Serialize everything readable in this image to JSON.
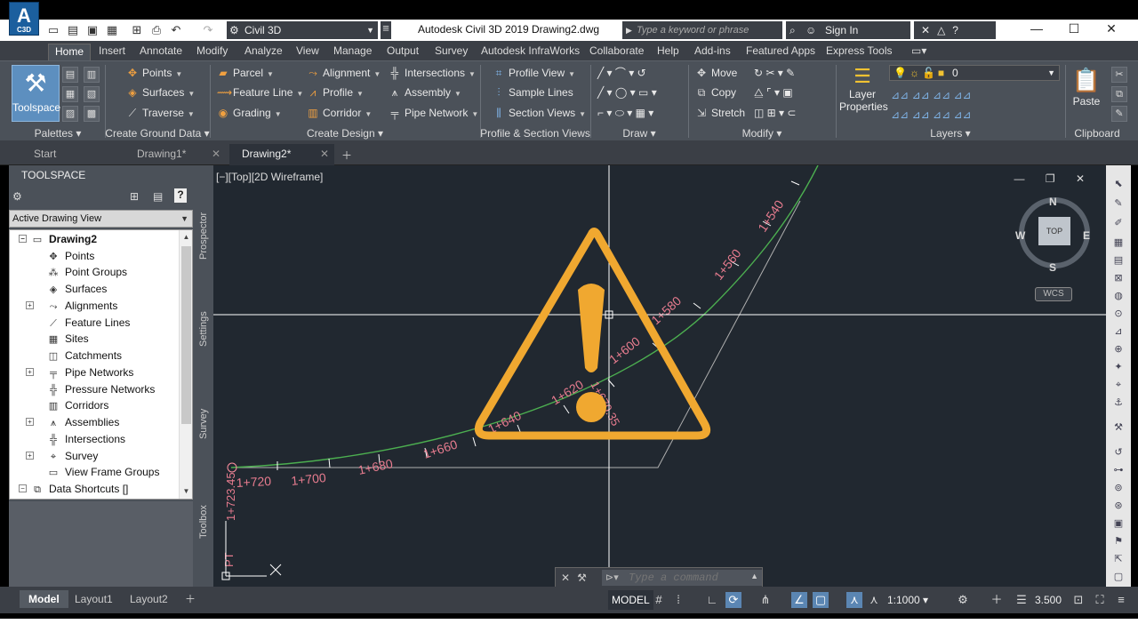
{
  "titlebar": {
    "logo_text": "A",
    "logo_sub": "C3D",
    "workspace": "Civil 3D",
    "app_title": "Autodesk Civil 3D 2019",
    "doc_title": "Drawing2.dwg",
    "search_placeholder": "Type a keyword or phrase",
    "sign_in": "Sign In"
  },
  "ribbon_tabs": [
    "Home",
    "Insert",
    "Annotate",
    "Modify",
    "Analyze",
    "View",
    "Manage",
    "Output",
    "Survey",
    "Autodesk InfraWorks",
    "Collaborate",
    "Help",
    "Add-ins",
    "Featured Apps",
    "Express Tools"
  ],
  "ribbon": {
    "toolspace": "Toolspace",
    "create_ground": [
      "Points",
      "Surfaces",
      "Traverse"
    ],
    "create_design_col1": [
      "Parcel",
      "Feature Line",
      "Grading"
    ],
    "create_design_col2": [
      "Alignment",
      "Profile",
      "Corridor"
    ],
    "create_design_col3": [
      "Intersections",
      "Assembly",
      "Pipe Network"
    ],
    "profile_section": [
      "Profile View",
      "Sample Lines",
      "Section Views"
    ],
    "modify": [
      "Move",
      "Copy",
      "Stretch"
    ],
    "layer_properties": "Layer Properties",
    "layer_current": "0",
    "paste": "Paste",
    "panels": {
      "palettes": "Palettes",
      "create_ground_data": "Create Ground Data",
      "create_design": "Create Design",
      "profile_section_views": "Profile & Section Views",
      "draw": "Draw",
      "modify": "Modify",
      "layers": "Layers",
      "clipboard": "Clipboard"
    }
  },
  "doc_tabs": [
    "Start",
    "Drawing1*",
    "Drawing2*"
  ],
  "toolspace": {
    "title": "TOOLSPACE",
    "view": "Active Drawing View",
    "root": "Drawing2",
    "items": [
      "Points",
      "Point Groups",
      "Surfaces",
      "Alignments",
      "Feature Lines",
      "Sites",
      "Catchments",
      "Pipe Networks",
      "Pressure Networks",
      "Corridors",
      "Assemblies",
      "Intersections",
      "Survey",
      "View Frame Groups"
    ],
    "data_shortcuts": "Data Shortcuts []",
    "vtabs": [
      "Prospector",
      "Settings",
      "Survey",
      "Toolbox"
    ]
  },
  "viewport": {
    "label": "[−][Top][2D Wireframe]",
    "viewcube": {
      "top": "TOP",
      "n": "N",
      "s": "S",
      "e": "E",
      "w": "W"
    },
    "wcs": "WCS",
    "stations": [
      "1+540",
      "1+560",
      "1+580",
      "1+600",
      "1+620",
      "1+640",
      "1+660",
      "1+680",
      "1+700",
      "1+720"
    ],
    "station_extra": [
      "1+670.35",
      "1+723.45"
    ],
    "pt_label": "PT"
  },
  "command": {
    "placeholder": "Type a command"
  },
  "statusbar": {
    "layouts": [
      "Model",
      "Layout1",
      "Layout2"
    ],
    "model": "MODEL",
    "scale": "1:1000",
    "annot": "3.500"
  }
}
